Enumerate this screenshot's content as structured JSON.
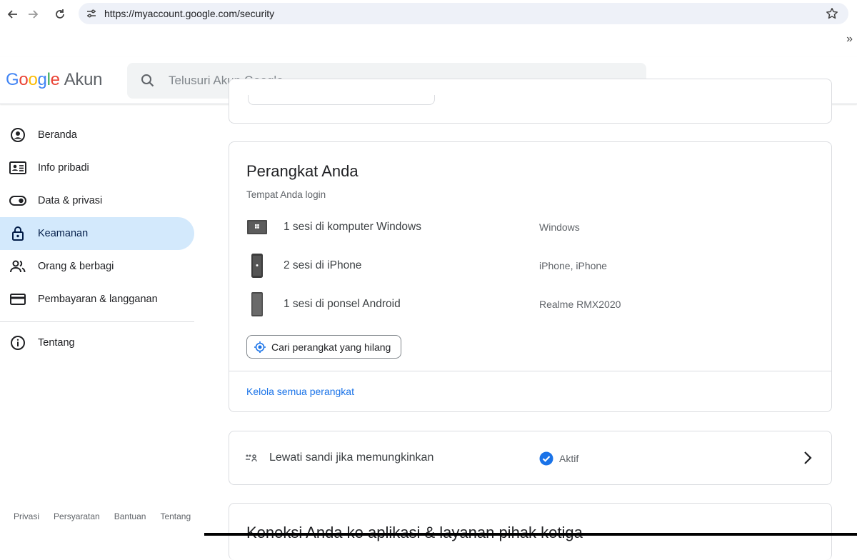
{
  "browser": {
    "url": "https://myaccount.google.com/security",
    "extensions_label": "»"
  },
  "header": {
    "logo_letters": [
      "G",
      "o",
      "o",
      "g",
      "l",
      "e"
    ],
    "logo_colors": [
      "#4285f4",
      "#ea4335",
      "#fbbc05",
      "#4285f4",
      "#34a853",
      "#ea4335"
    ],
    "akun_label": "Akun",
    "search_placeholder": "Telusuri Akun Google"
  },
  "sidebar": {
    "items": [
      {
        "label": "Beranda",
        "icon": "home-account-icon"
      },
      {
        "label": "Info pribadi",
        "icon": "id-card-icon"
      },
      {
        "label": "Data & privasi",
        "icon": "toggle-icon"
      },
      {
        "label": "Keamanan",
        "icon": "lock-icon",
        "active": true
      },
      {
        "label": "Orang & berbagi",
        "icon": "people-icon"
      },
      {
        "label": "Pembayaran & langganan",
        "icon": "credit-card-icon"
      }
    ],
    "about": {
      "label": "Tentang",
      "icon": "info-icon"
    },
    "footer": [
      "Privasi",
      "Persyaratan",
      "Bantuan",
      "Tentang"
    ]
  },
  "devices": {
    "title": "Perangkat Anda",
    "subtitle": "Tempat Anda login",
    "rows": [
      {
        "name": "1 sesi di komputer Windows",
        "type": "Windows",
        "icon": "windows-computer-icon"
      },
      {
        "name": "2 sesi di iPhone",
        "type": "iPhone, iPhone",
        "icon": "iphone-icon"
      },
      {
        "name": "1 sesi di ponsel Android",
        "type": "Realme RMX2020",
        "icon": "android-phone-icon"
      }
    ],
    "find_button": "Cari perangkat yang hilang",
    "manage_link": "Kelola semua perangkat"
  },
  "passkey": {
    "label": "Lewati sandi jika memungkinkan",
    "status": "Aktif",
    "status_color": "#1a73e8"
  },
  "third_party": {
    "title": "Koneksi Anda ke aplikasi & layanan pihak ketiga"
  }
}
